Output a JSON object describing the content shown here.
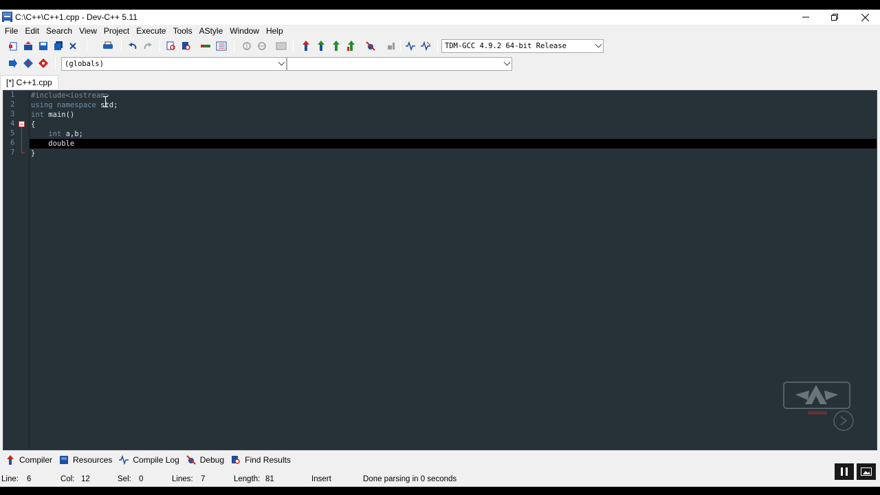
{
  "window": {
    "title": "C:\\C++\\C++1.cpp - Dev-C++ 5.11"
  },
  "menu": [
    "File",
    "Edit",
    "Search",
    "View",
    "Project",
    "Execute",
    "Tools",
    "AStyle",
    "Window",
    "Help"
  ],
  "toolbar": {
    "compiler_select": "TDM-GCC 4.9.2 64-bit Release",
    "scope_select": "(globals)",
    "member_select": ""
  },
  "file_tab": "[*] C++1.cpp",
  "editor": {
    "line_numbers": [
      "1",
      "2",
      "3",
      "4",
      "5",
      "6",
      "7"
    ],
    "lines": [
      [
        {
          "t": "#include<iostream>",
          "k": "pre"
        }
      ],
      [
        {
          "t": "using namespace ",
          "k": "kw"
        },
        {
          "t": "std;",
          "k": "txt"
        }
      ],
      [
        {
          "t": "int ",
          "k": "kw"
        },
        {
          "t": "main()",
          "k": "txt"
        }
      ],
      [
        {
          "t": "{",
          "k": "txt"
        }
      ],
      [
        {
          "t": "    ",
          "k": "txt"
        },
        {
          "t": "int ",
          "k": "kw"
        },
        {
          "t": "a,b;",
          "k": "txt"
        }
      ],
      [
        {
          "t": "    double",
          "k": "txt"
        }
      ],
      [
        {
          "t": "}",
          "k": "txt"
        }
      ]
    ],
    "active_line": 6
  },
  "bottom_tabs": [
    {
      "label": "Compiler",
      "icon": "compiler-icon"
    },
    {
      "label": "Resources",
      "icon": "resources-icon"
    },
    {
      "label": "Compile Log",
      "icon": "compile-log-icon"
    },
    {
      "label": "Debug",
      "icon": "debug-icon"
    },
    {
      "label": "Find Results",
      "icon": "find-results-icon"
    }
  ],
  "status": {
    "line_label": "Line:",
    "line_value": "6",
    "col_label": "Col:",
    "col_value": "12",
    "sel_label": "Sel:",
    "sel_value": "0",
    "lines_label": "Lines:",
    "lines_value": "7",
    "length_label": "Length:",
    "length_value": "81",
    "mode": "Insert",
    "message": "Done parsing in 0 seconds"
  }
}
